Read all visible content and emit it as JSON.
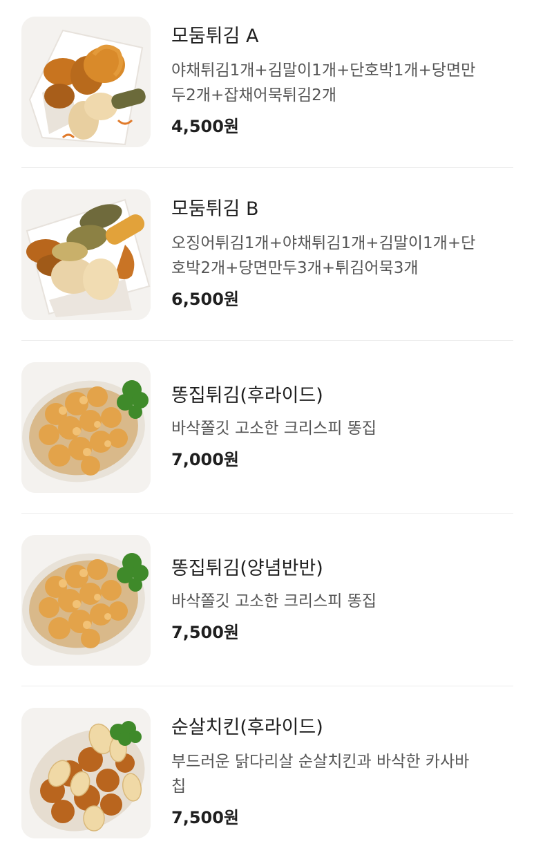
{
  "menu": {
    "items": [
      {
        "name": "모둠튀김 A",
        "desc_lines": [
          "야채튀김1개+김말이1개+단호박1개+당면만",
          "두2개+잡채어묵튀김2개"
        ],
        "price": "4,500원"
      },
      {
        "name": "모둠튀김 B",
        "desc_lines": [
          "오징어튀김1개+야채튀김1개+김말이1개+단",
          "호박2개+당면만두3개+튀김어묵3개"
        ],
        "price": "6,500원"
      },
      {
        "name": "똥집튀김(후라이드)",
        "desc_lines": [
          "바삭쫄깃 고소한 크리스피 똥집"
        ],
        "price": "7,000원"
      },
      {
        "name": "똥집튀김(양념반반)",
        "desc_lines": [
          "바삭쫄깃 고소한 크리스피 똥집"
        ],
        "price": "7,500원"
      },
      {
        "name": "순살치킨(후라이드)",
        "desc_lines": [
          "부드러운 닭다리살 순살치킨과 바삭한 카사바",
          "칩"
        ],
        "price": "7,500원"
      }
    ]
  },
  "colors": {
    "text_primary": "#1f1f1f",
    "text_secondary": "#555555",
    "divider": "#ececec",
    "thumb_bg": "#f3f3f3"
  }
}
